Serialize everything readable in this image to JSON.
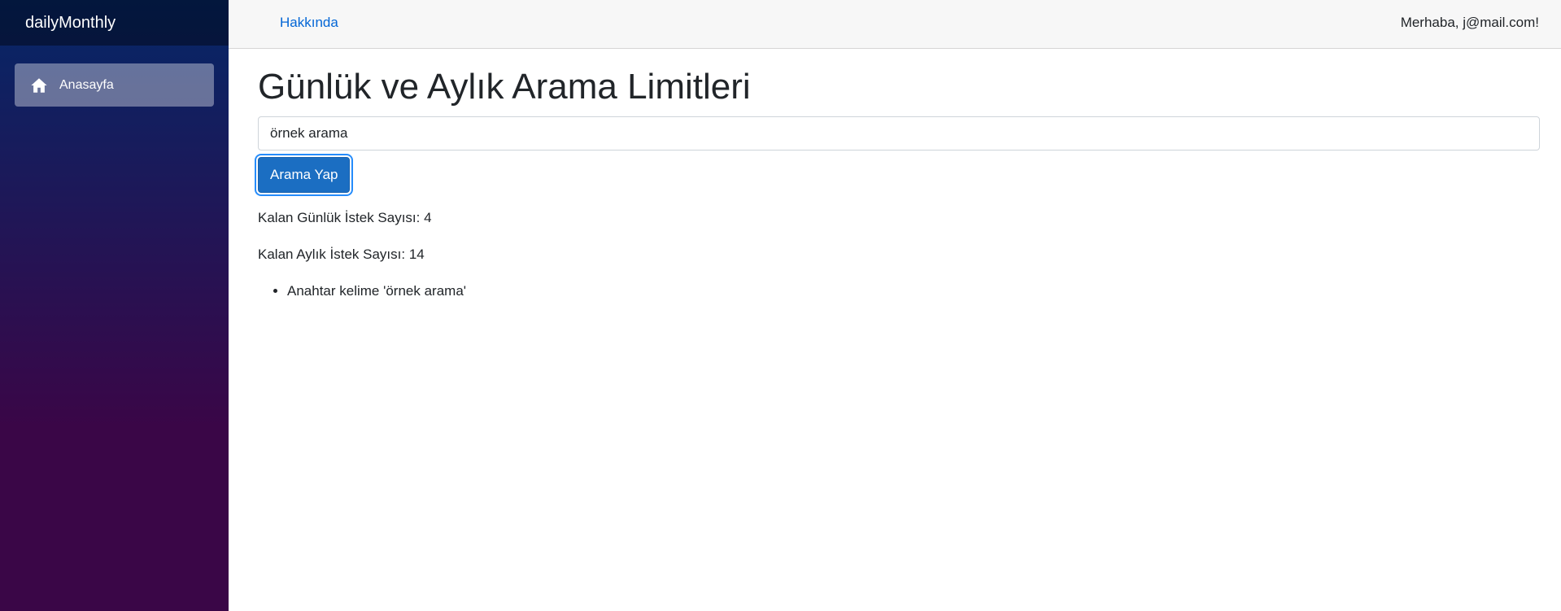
{
  "sidebar": {
    "brand": "dailyMonthly",
    "items": [
      {
        "label": "Anasayfa",
        "icon": "home-icon"
      }
    ]
  },
  "top_row": {
    "about_link": "Hakkında",
    "greeting": "Merhaba, j@mail.com!"
  },
  "main": {
    "title": "Günlük ve Aylık Arama Limitleri",
    "search_value": "örnek arama",
    "search_button": "Arama Yap",
    "daily_remaining": "Kalan Günlük İstek Sayısı: 4",
    "monthly_remaining": "Kalan Aylık İstek Sayısı: 14",
    "results": [
      "Anahtar kelime 'örnek arama'"
    ]
  },
  "colors": {
    "sidebar_gradient_top": "#052767",
    "sidebar_gradient_bottom": "#3a0647",
    "primary_button": "#1b6ec2",
    "link": "#0366d6"
  }
}
